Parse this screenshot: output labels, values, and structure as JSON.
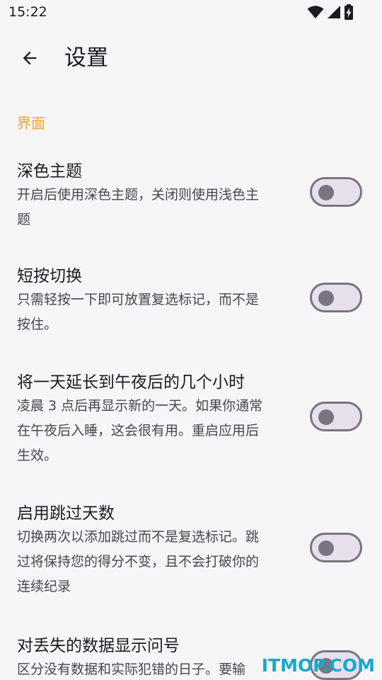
{
  "status_bar": {
    "time": "15:22",
    "icons": [
      "wifi-icon",
      "cellular-signal-icon",
      "battery-charging-icon"
    ]
  },
  "app_bar": {
    "back_icon": "arrow-left-icon",
    "title": "设置"
  },
  "section": {
    "title": "界面"
  },
  "settings": [
    {
      "title": "深色主题",
      "summary": [
        "开启后使用深色主题，关闭则使用浅色主",
        "题"
      ],
      "enabled": false
    },
    {
      "title": "短按切换",
      "summary": [
        "只需轻按一下即可放置复选标记，而不是",
        "按住。"
      ],
      "enabled": false
    },
    {
      "title": "将一天延长到午夜后的几个小时",
      "summary": [
        "凌晨 3 点后再显示新的一天。如果你通常",
        "在午夜后入睡，这会很有用。重启应用后",
        "生效。"
      ],
      "enabled": false
    },
    {
      "title": "启用跳过天数",
      "summary": [
        "切换两次以添加跳过而不是复选标记。跳",
        "过将保持您的得分不变，且不会打破你的",
        "连续纪录"
      ],
      "enabled": false
    },
    {
      "title": "对丢失的数据显示问号",
      "summary": [
        "区分没有数据和实际犯错的日子。要输"
      ],
      "enabled": false
    }
  ],
  "watermark": "ITMOP.COM",
  "colors": {
    "background": "#f6f5f7",
    "accent": "#f5a623",
    "switch_outline": "#79747e",
    "switch_track": "#e7e0ec",
    "watermark": "#18a9c9"
  }
}
